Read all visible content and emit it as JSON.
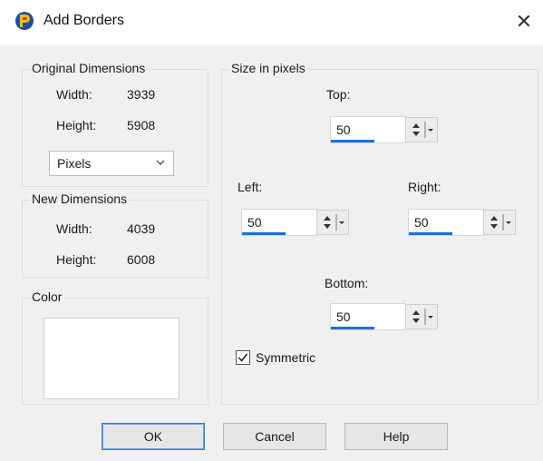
{
  "window": {
    "title": "Add Borders",
    "close_glyph": "✕"
  },
  "original": {
    "group_label": "Original Dimensions",
    "width_label": "Width:",
    "width_value": "3939",
    "height_label": "Height:",
    "height_value": "5908",
    "units_value": "Pixels"
  },
  "new_dims": {
    "group_label": "New Dimensions",
    "width_label": "Width:",
    "width_value": "4039",
    "height_label": "Height:",
    "height_value": "6008"
  },
  "color": {
    "group_label": "Color",
    "swatch_color": "#ffffff"
  },
  "size": {
    "group_label": "Size in pixels",
    "top_label": "Top:",
    "top_value": "50",
    "left_label": "Left:",
    "left_value": "50",
    "right_label": "Right:",
    "right_value": "50",
    "bottom_label": "Bottom:",
    "bottom_value": "50",
    "symmetric_label": "Symmetric",
    "symmetric_checked": true
  },
  "buttons": {
    "ok": "OK",
    "cancel": "Cancel",
    "help": "Help"
  },
  "accent_color": "#1e6fd6",
  "icons": [
    "app-icon",
    "close-icon",
    "chevron-down-icon",
    "spin-up-down-icon",
    "checkmark-icon"
  ]
}
